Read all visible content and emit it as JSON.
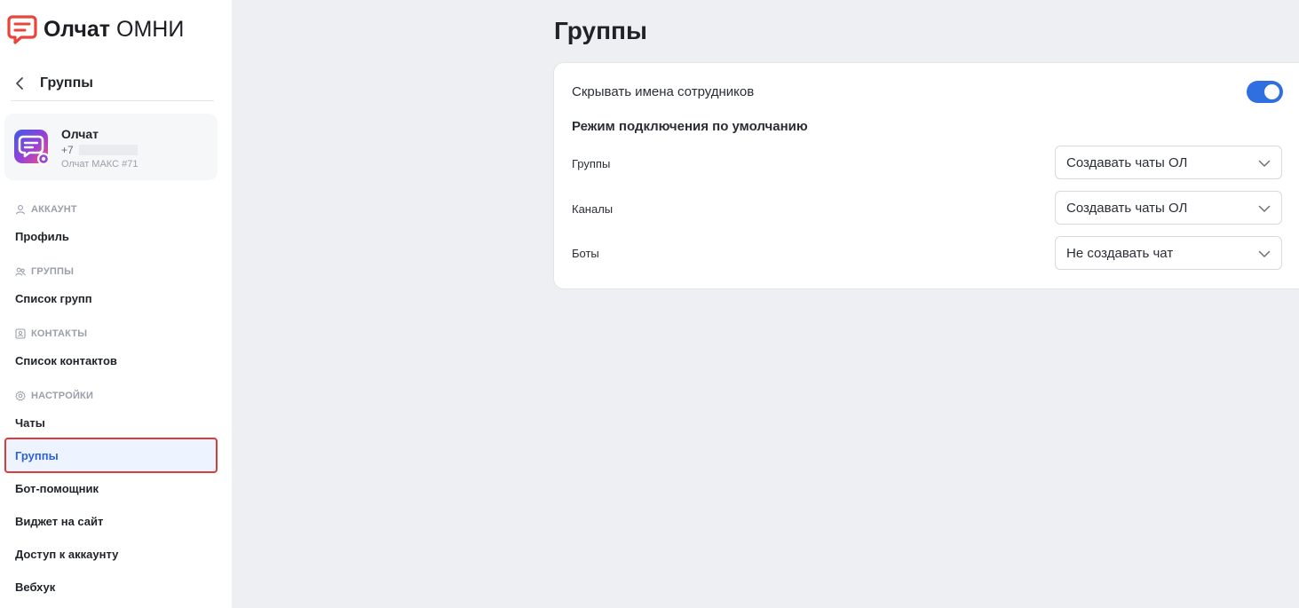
{
  "brand": {
    "name_bold": "Олчат",
    "name_rest": " ОМНИ",
    "color": "#e8453c"
  },
  "sidebar": {
    "back_icon": "chevron-left-icon",
    "back_title": "Группы",
    "account": {
      "name": "Олчат",
      "phone_prefix": "+7",
      "subtitle": "Олчат МАКС #71"
    },
    "sections": [
      {
        "icon": "user-icon",
        "title": "АККАУНТ",
        "items": [
          "Профиль"
        ]
      },
      {
        "icon": "users-icon",
        "title": "ГРУППЫ",
        "items": [
          "Список групп"
        ]
      },
      {
        "icon": "contacts-icon",
        "title": "КОНТАКТЫ",
        "items": [
          "Список контактов"
        ]
      },
      {
        "icon": "gear-icon",
        "title": "НАСТРОЙКИ",
        "items": [
          "Чаты",
          "Группы",
          "Бот-помощник",
          "Виджет на сайт",
          "Доступ к аккаунту",
          "Вебхук"
        ]
      }
    ],
    "active_item": "Группы"
  },
  "main": {
    "title": "Группы",
    "hide_names_label": "Скрывать имена сотрудников",
    "hide_names_on": true,
    "mode_heading": "Режим подключения по умолчанию",
    "options": [
      {
        "label": "Группы",
        "value": "Создавать чаты ОЛ"
      },
      {
        "label": "Каналы",
        "value": "Создавать чаты ОЛ"
      },
      {
        "label": "Боты",
        "value": "Не создавать чат"
      }
    ]
  },
  "colors": {
    "accent": "#2f6fe0",
    "active_text": "#2f62d9",
    "highlight_border": "#dc3b3b"
  }
}
